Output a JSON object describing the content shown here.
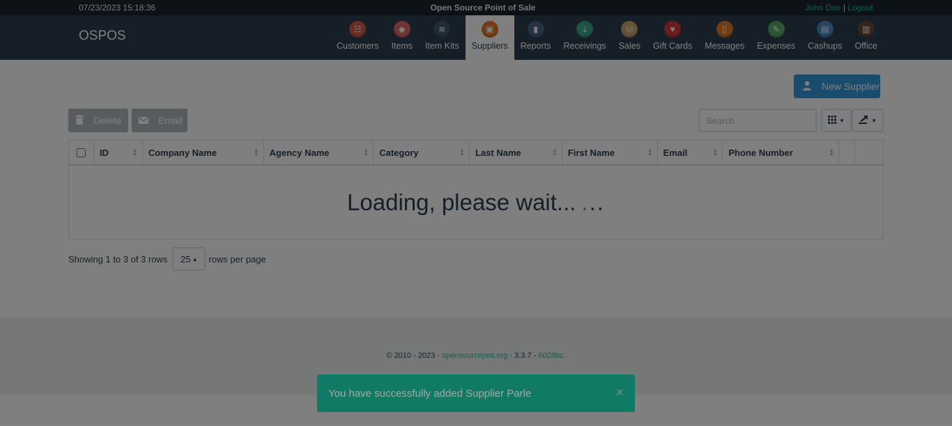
{
  "topbar": {
    "datetime": "07/23/2023 15:18:36",
    "app_title": "Open Source Point of Sale",
    "user": "John Doe",
    "separator": "|",
    "logout": "Logout"
  },
  "navbar": {
    "brand": "OSPOS",
    "items": [
      {
        "label": "Customers",
        "icon": "customers-icon",
        "color": "#d35d4a",
        "glyph": "☷"
      },
      {
        "label": "Items",
        "icon": "items-icon",
        "color": "#e06c6c",
        "glyph": "◆"
      },
      {
        "label": "Item Kits",
        "icon": "item-kits-icon",
        "color": "#3f5a6e",
        "glyph": "≋"
      },
      {
        "label": "Suppliers",
        "icon": "suppliers-icon",
        "color": "#e07b2e",
        "glyph": "▣"
      },
      {
        "label": "Reports",
        "icon": "reports-icon",
        "color": "#4a6780",
        "glyph": "▮"
      },
      {
        "label": "Receivings",
        "icon": "receivings-icon",
        "color": "#3aa88a",
        "glyph": "⇣"
      },
      {
        "label": "Sales",
        "icon": "sales-icon",
        "color": "#c9a66b",
        "glyph": "⛁"
      },
      {
        "label": "Gift Cards",
        "icon": "gift-cards-icon",
        "color": "#d33b3b",
        "glyph": "♥"
      },
      {
        "label": "Messages",
        "icon": "messages-icon",
        "color": "#e07b2e",
        "glyph": "▯"
      },
      {
        "label": "Expenses",
        "icon": "expenses-icon",
        "color": "#5aaa6a",
        "glyph": "✎"
      },
      {
        "label": "Cashups",
        "icon": "cashups-icon",
        "color": "#4a8ec2",
        "glyph": "▤"
      },
      {
        "label": "Office",
        "icon": "office-icon",
        "color": "#6b4d3a",
        "glyph": "▥"
      }
    ],
    "active": "Suppliers"
  },
  "toolbar": {
    "new_label": "New Supplier",
    "delete_label": "Delete",
    "email_label": "Email",
    "search_placeholder": "Search"
  },
  "table": {
    "columns": [
      "ID",
      "Company Name",
      "Agency Name",
      "Category",
      "Last Name",
      "First Name",
      "Email",
      "Phone Number"
    ],
    "loading_text": "Loading, please wait...",
    "loading_dots": "...",
    "loading_dots_colors": [
      "#7b8a8b",
      "#2c3e50",
      "#2c3e50"
    ]
  },
  "pagination": {
    "showing": "Showing 1 to 3 of 3 rows",
    "page_size": "25",
    "per_page": "rows per page"
  },
  "footer": {
    "copyright": "© 2010 - 2023 · ",
    "site": "opensourcepos.org",
    "version": " · 3.3.7 - ",
    "commit": "6028bc."
  },
  "notification": {
    "message": "You have successfully added Supplier Parle",
    "close": "×"
  }
}
